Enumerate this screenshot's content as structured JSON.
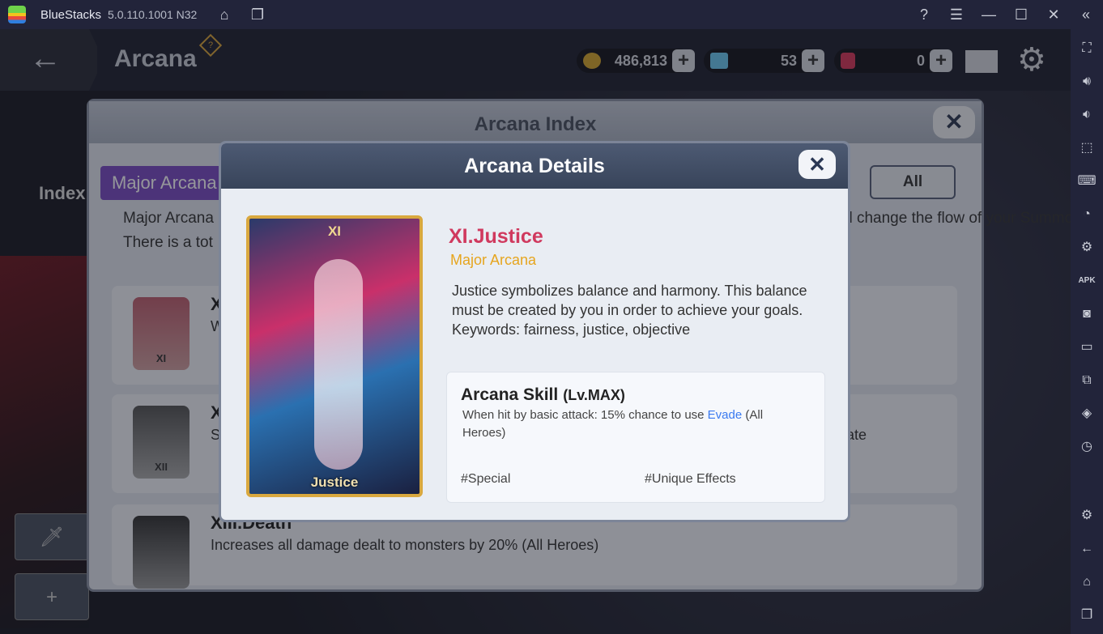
{
  "window": {
    "app_name": "BlueStacks",
    "version": "5.0.110.1001 N32"
  },
  "titlebar_icons": [
    "home-icon",
    "multi-instance-icon",
    "help-icon",
    "menu-icon",
    "minimize-icon",
    "close-icon",
    "collapse-icon"
  ],
  "sidebar_icons": [
    "fullscreen-icon",
    "volume-up-icon",
    "volume-down-icon",
    "pointer-icon",
    "keyboard-icon",
    "record-icon",
    "controls-icon",
    "apk-icon",
    "screenshot-icon",
    "folder-icon",
    "multi-window-icon",
    "layers-icon",
    "speed-icon",
    "settings-icon",
    "back-icon",
    "home-icon",
    "recents-icon"
  ],
  "game": {
    "screen_title": "Arcana",
    "currencies": [
      {
        "name": "gold",
        "value": "486,813",
        "color": "#d6a72c"
      },
      {
        "name": "diamond",
        "value": "53",
        "color": "#6cc8f0"
      },
      {
        "name": "ruby",
        "value": "0",
        "color": "#d8385a"
      }
    ],
    "index_label": "Index",
    "index_panel": {
      "title": "Arcana Index",
      "tab": "Major Arcana",
      "filter": "All",
      "desc_line1_a": "Major Arcana",
      "desc_line1_b": "they influence fate itself. They will change the flow of your Summoning.",
      "desc_line2": "There is a tot",
      "rows": [
        {
          "num": "XI",
          "title": "XI",
          "text": "When"
        },
        {
          "num": "XII",
          "title": "XI",
          "text": "S",
          "text_right": "ctivate"
        },
        {
          "num": "",
          "title": "XIII.Death",
          "text": "Increases all damage dealt to monsters by 20% (All Heroes)"
        }
      ]
    },
    "dialog": {
      "title": "Arcana Details",
      "card_number": "XI",
      "card_name": "Justice",
      "arcana_title": "XI.Justice",
      "arcana_type": "Major Arcana",
      "description": "Justice symbolizes balance and harmony. This balance must be created by you in order to achieve your goals.",
      "keywords": "Keywords: fairness, justice, objective",
      "skill": {
        "title": "Arcana Skill",
        "level": "(Lv.MAX)",
        "text_before": "When hit by basic attack: 15% chance to use ",
        "link": "Evade",
        "text_after": " (All Heroes)",
        "tags": [
          "#Special",
          "#Unique Effects"
        ]
      }
    }
  }
}
